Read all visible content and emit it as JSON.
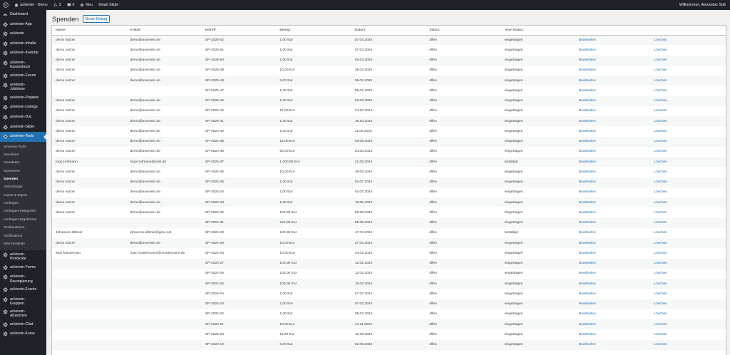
{
  "adminbar": {
    "site_name": "asVerein - Demo",
    "updates_count": "3",
    "comments_count": "0",
    "new_label": "Neu",
    "smart_slider_label": "Smart Slider",
    "welcome_text": "Willkommen, Alexander Süß"
  },
  "sidebar": {
    "items_top": [
      {
        "label": "Dashboard",
        "icon": "dashboard-icon"
      },
      {
        "label": "asVerein-App",
        "icon": "gear-icon"
      },
      {
        "label": "asVerein",
        "icon": "gear-icon"
      },
      {
        "label": "asVerein-Inhalte",
        "icon": "gear-icon"
      },
      {
        "label": "asVerein-Inventar",
        "icon": "gear-icon"
      },
      {
        "label": "asVerein-\nKassenbuch",
        "icon": "gear-icon"
      },
      {
        "label": "asVerein-Forum",
        "icon": "gear-icon"
      },
      {
        "label": "asVerein-\nJobbörse",
        "icon": "gear-icon"
      },
      {
        "label": "asVerein-Projekte",
        "icon": "gear-icon"
      },
      {
        "label": "asVerein-Listings",
        "icon": "gear-icon"
      },
      {
        "label": "asVerein-Doc",
        "icon": "gear-icon"
      },
      {
        "label": "asVerein-Slider",
        "icon": "gear-icon"
      }
    ],
    "active_item": {
      "label": "asVerein-Tools",
      "icon": "gear-icon"
    },
    "submenu": [
      "asVerein-Tools",
      "Newsfeed",
      "Newsletter",
      "Sponsoren",
      "Spenden",
      "Geburtstage",
      "Import & Export",
      "Umfragen",
      "Umfragen-Kategorien",
      "Umfragen-Ergebnisse",
      "Textbausteine",
      "Notifications",
      "Mail-Template"
    ],
    "current_sub_index": 4,
    "items_bottom": [
      {
        "label": "asVerein-\nProtokolle",
        "icon": "gear-icon"
      },
      {
        "label": "asVerein-Forms",
        "icon": "gear-icon"
      },
      {
        "label": "asVerein-\nRaumplanung",
        "icon": "gear-icon"
      },
      {
        "label": "asVerein-Events",
        "icon": "gear-icon"
      },
      {
        "label": "asVerein-\nGruppen",
        "icon": "gear-icon"
      },
      {
        "label": "asVerein-\nAbzeichen",
        "icon": "gear-icon"
      },
      {
        "label": "asVerein-Chat",
        "icon": "gear-icon"
      },
      {
        "label": "asVerein-Kurse",
        "icon": "gear-icon"
      }
    ]
  },
  "page": {
    "title": "Spenden",
    "add_new_label": "Neuer Eintrag"
  },
  "table": {
    "columns": [
      "Name:",
      "E-Mail:",
      "Betreff:",
      "Betrag:",
      "Datum:",
      "Status:",
      "User-Status:",
      "",
      ""
    ],
    "edit_label": "Bearbeiten",
    "delete_label": "Löschen",
    "rows": [
      [
        "demo nutzer",
        "demo@asverein.de",
        "SP-2025-52",
        "1,00 Eur",
        "07.04.2025",
        "offen",
        "eingetragen"
      ],
      [
        "demo nutzer",
        "demo@asverein.de",
        "SP-2025-51",
        "1,00 Eur",
        "07.04.2025",
        "offen",
        "eingetragen"
      ],
      [
        "demo nutzer",
        "demo@asverein.de",
        "SP-2025-50",
        "1,00 Eur",
        "03.04.2025",
        "offen",
        "eingetragen"
      ],
      [
        "demo nutzer",
        "demo@asverein.de",
        "SP-2025-49",
        "10,00 Eur",
        "26.03.2025",
        "offen",
        "eingetragen"
      ],
      [
        "demo nutzer",
        "demo@asverein.de",
        "SP-2025-48",
        "5,00 Eur",
        "06.03.2025",
        "offen",
        "eingetragen"
      ],
      [
        "",
        "",
        "SP-2025-47",
        "1,00 Eur",
        "09.02.2025",
        "offen",
        "eingetragen"
      ],
      [
        "demo nutzer",
        "demo@asverein.de",
        "SP-2025-46",
        "1,00 Eur",
        "02.02.2025",
        "offen",
        "eingetragen"
      ],
      [
        "demo nutzer",
        "demo@asverein.de",
        "SP-2024-42",
        "12,00 Eur",
        "24.10.2024",
        "offen",
        "eingetragen"
      ],
      [
        "demo nutzer",
        "demo@asverein.de",
        "SP-2024-41",
        "1,00 Eur",
        "18.10.2024",
        "offen",
        "eingetragen"
      ],
      [
        "demo nutzer",
        "demo@asverein.de",
        "SP-2024-40",
        "1,00 Eur",
        "11.09.2024",
        "offen",
        "eingetragen"
      ],
      [
        "demo nutzer",
        "demo@asverein.de",
        "SP-2024-39",
        "12,00 Eur",
        "03.09.2024",
        "offen",
        "eingetragen"
      ],
      [
        "demo nutzer",
        "demo@asverein.de",
        "SP-2024-38",
        "50,00 Eur",
        "24.08.2024",
        "offen",
        "eingetragen"
      ],
      [
        "Ingo Hofmann",
        "ingo-hofmann@web.de",
        "SP-2024-37",
        "1.000,00 Eur",
        "21.08.2024",
        "offen",
        "bestätigt"
      ],
      [
        "demo nutzer",
        "demo@asverein.de",
        "SP-2024-36",
        "10,00 Eur",
        "18.08.2024",
        "offen",
        "eingetragen"
      ],
      [
        "demo nutzer",
        "demo@asverein.de",
        "SP-2024-35",
        "1,00 Eur",
        "02.07.2024",
        "offen",
        "eingetragen"
      ],
      [
        "demo nutzer",
        "demo@asverein.de",
        "SP-2024-34",
        "1,00 Eur",
        "02.07.2024",
        "offen",
        "eingetragen"
      ],
      [
        "demo nutzer",
        "demo@asverein.de",
        "SP-2024-33",
        "1,00 Eur",
        "19.05.2024",
        "offen",
        "eingetragen"
      ],
      [
        "demo nutzer",
        "demo@asverein.de",
        "SP-2024-32",
        "100,00 Eur",
        "08.05.2024",
        "offen",
        "eingetragen"
      ],
      [
        "",
        "",
        "SP-2024-31",
        "223,00 Eur",
        "05.05.2024",
        "offen",
        "eingetragen"
      ],
      [
        "Johannes Slittner",
        "johannes.slittner@gmx.net",
        "SP-2024-30",
        "100,00 Eur",
        "17.04.2024",
        "offen",
        "bestätigt"
      ],
      [
        "demo nutzer",
        "demo@asverein.de",
        "SP-2024-29",
        "10,00 Eur",
        "27.03.2024",
        "offen",
        "eingetragen"
      ],
      [
        "Max Musterman",
        "max.mustermann@mustermann.de",
        "SP-2024-28",
        "10,00 Eur",
        "24.02.2024",
        "offen",
        "eingetragen"
      ],
      [
        "",
        "",
        "SP-2024-27",
        "100,00 Eur",
        "12.02.2024",
        "offen",
        "eingetragen"
      ],
      [
        "",
        "",
        "SP-2024-26",
        "100,00 Eur",
        "12.02.2024",
        "offen",
        "eingetragen"
      ],
      [
        "",
        "",
        "SP-2024-25",
        "100,00 Eur",
        "10.02.2024",
        "offen",
        "eingetragen"
      ],
      [
        "",
        "",
        "SP-2024-24",
        "1,00 Eur",
        "07.02.2024",
        "offen",
        "eingetragen"
      ],
      [
        "",
        "",
        "SP-2024-23",
        "1,00 Eur",
        "07.02.2024",
        "offen",
        "eingetragen"
      ],
      [
        "",
        "",
        "SP-2024-22",
        "1,00 Eur",
        "05.02.2024",
        "offen",
        "eingetragen"
      ],
      [
        "",
        "",
        "SP-2023-21",
        "10,00 Eur",
        "13.11.2023",
        "offen",
        "eingetragen"
      ],
      [
        "",
        "",
        "SP-2023-20",
        "11,00 Eur",
        "12.09.2023",
        "offen",
        "eingetragen"
      ],
      [
        "",
        "",
        "SP-2023-19",
        "5,00 Eur",
        "02.08.2023",
        "offen",
        "eingetragen"
      ]
    ]
  },
  "colors": {
    "admin_dark": "#1d2327",
    "accent": "#2271b1",
    "submenu_bg": "#2c3338"
  }
}
